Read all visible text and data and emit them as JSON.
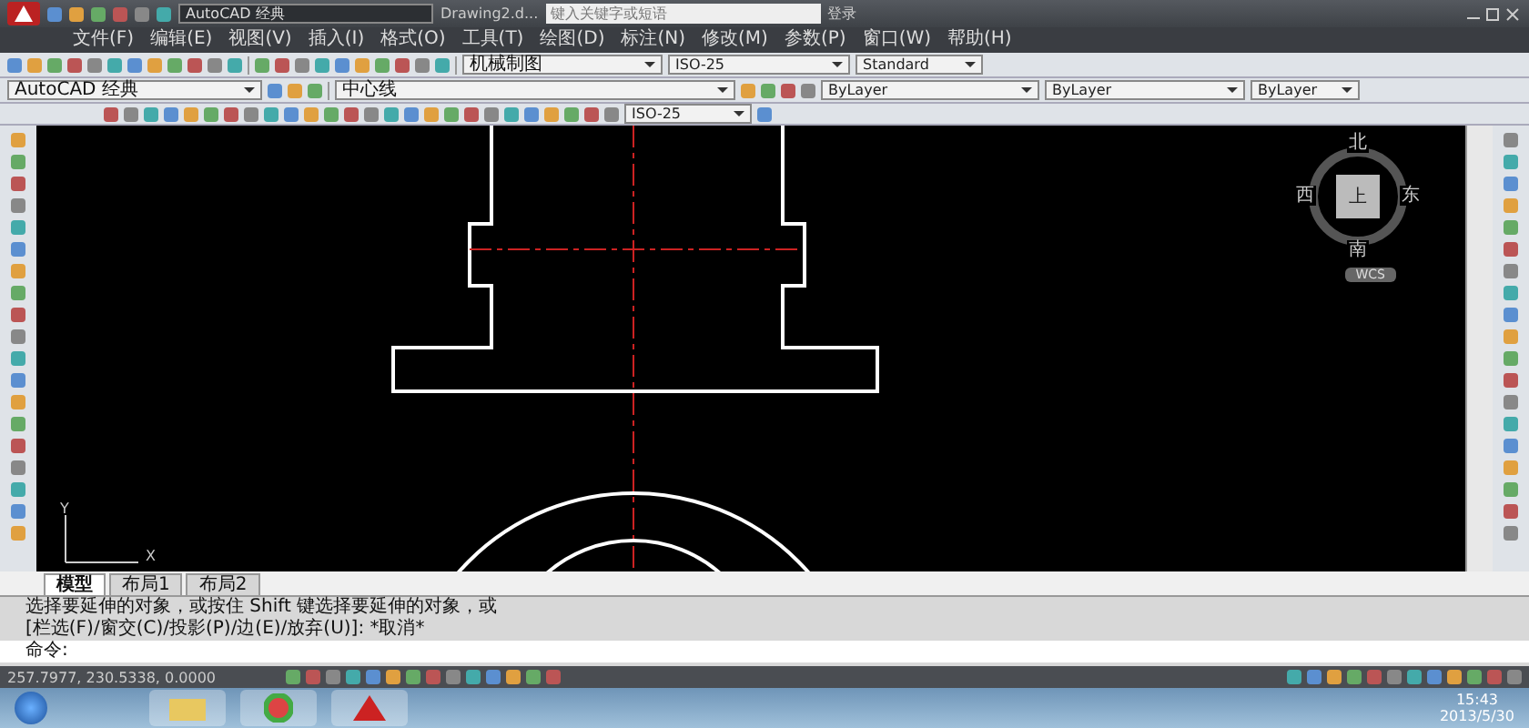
{
  "title_bar": {
    "workspace": "AutoCAD 经典",
    "document": "Drawing2.d...",
    "search_placeholder": "键入关键字或短语",
    "sign_in": "登录"
  },
  "menu": [
    "文件(F)",
    "编辑(E)",
    "视图(V)",
    "插入(I)",
    "格式(O)",
    "工具(T)",
    "绘图(D)",
    "标注(N)",
    "修改(M)",
    "参数(P)",
    "窗口(W)",
    "帮助(H)"
  ],
  "styles_toolbar": {
    "text_style": "机械制图",
    "dim_style": "ISO-25",
    "table_style": "Standard"
  },
  "layers_toolbar": {
    "workspace": "AutoCAD 经典",
    "layer": "中心线",
    "color_control": "ByLayer",
    "linetype": "ByLayer",
    "lineweight": "ByLayer"
  },
  "dim_toolbar": {
    "dim_style": "ISO-25"
  },
  "viewcube": {
    "face": "上",
    "north": "北",
    "east": "东",
    "south": "南",
    "west": "西",
    "ucs": "WCS"
  },
  "ucs_icon": {
    "x": "X",
    "y": "Y"
  },
  "tabs": [
    {
      "label": "模型",
      "selected": true
    },
    {
      "label": "布局1",
      "selected": false
    },
    {
      "label": "布局2",
      "selected": false
    }
  ],
  "command_lines": [
    "选择要延伸的对象，或按住 Shift 键选择要延伸的对象，或",
    "[栏选(F)/窗交(C)/投影(P)/边(E)/放弃(U)]:  *取消*"
  ],
  "command_prompt": "命令:",
  "status_bar": {
    "coordinates": "257.7977, 230.5338, 0.0000"
  },
  "taskbar": {
    "time": "15:43",
    "date": "2013/5/30"
  }
}
